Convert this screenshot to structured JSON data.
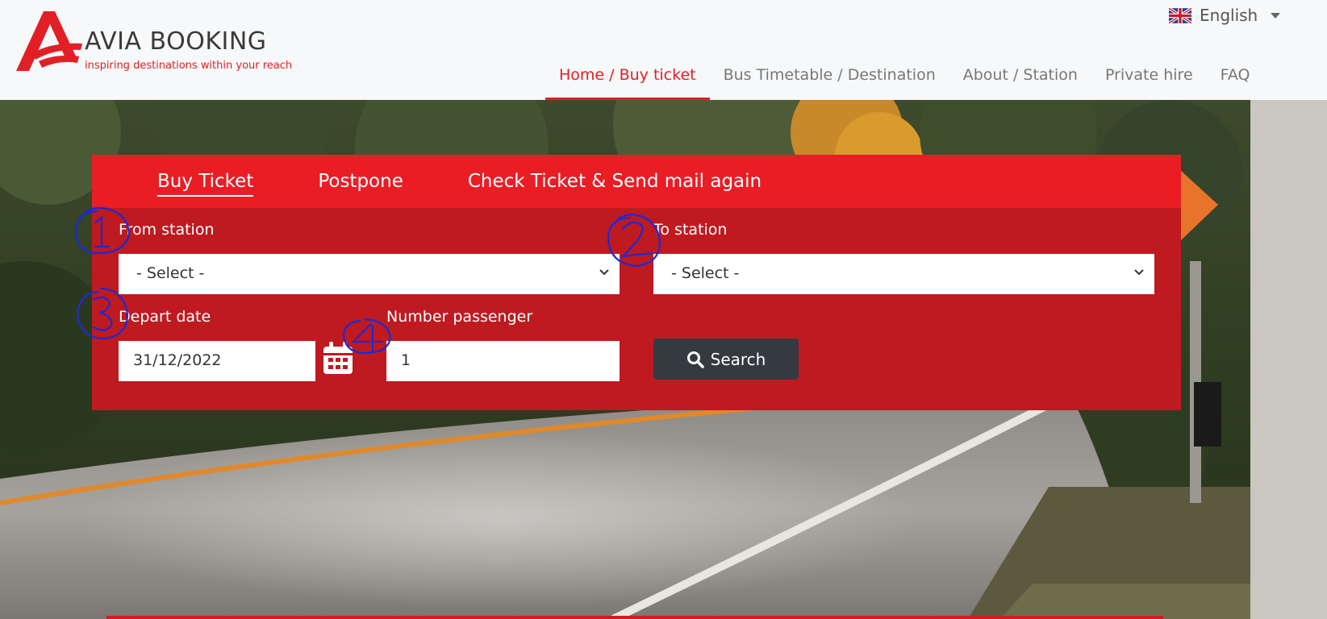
{
  "brand": {
    "name": "AVIA BOOKING",
    "tagline": "inspiring destinations within your reach",
    "color": "#e21f26"
  },
  "language": {
    "label": "English",
    "flag": "uk-flag-icon"
  },
  "nav": {
    "items": [
      {
        "label": "Home / Buy ticket",
        "active": true
      },
      {
        "label": "Bus Timetable / Destination",
        "active": false
      },
      {
        "label": "About / Station",
        "active": false
      },
      {
        "label": "Private hire",
        "active": false
      },
      {
        "label": "FAQ",
        "active": false
      }
    ]
  },
  "booking": {
    "tabs": [
      {
        "label": "Buy Ticket",
        "active": true
      },
      {
        "label": "Postpone",
        "active": false
      },
      {
        "label": "Check Ticket & Send mail again",
        "active": false
      }
    ],
    "from_label": "From station",
    "from_value": "- Select -",
    "to_label": "To station",
    "to_value": "- Select -",
    "date_label": "Depart date",
    "date_value": "31/12/2022",
    "passenger_label": "Number passenger",
    "passenger_value": "1",
    "search_label": "Search"
  },
  "colors": {
    "panel_dark": "#be1a20",
    "panel_tabs": "#ea1d25",
    "search_button": "#343a40",
    "annotation_ink": "#1a2bd6"
  }
}
